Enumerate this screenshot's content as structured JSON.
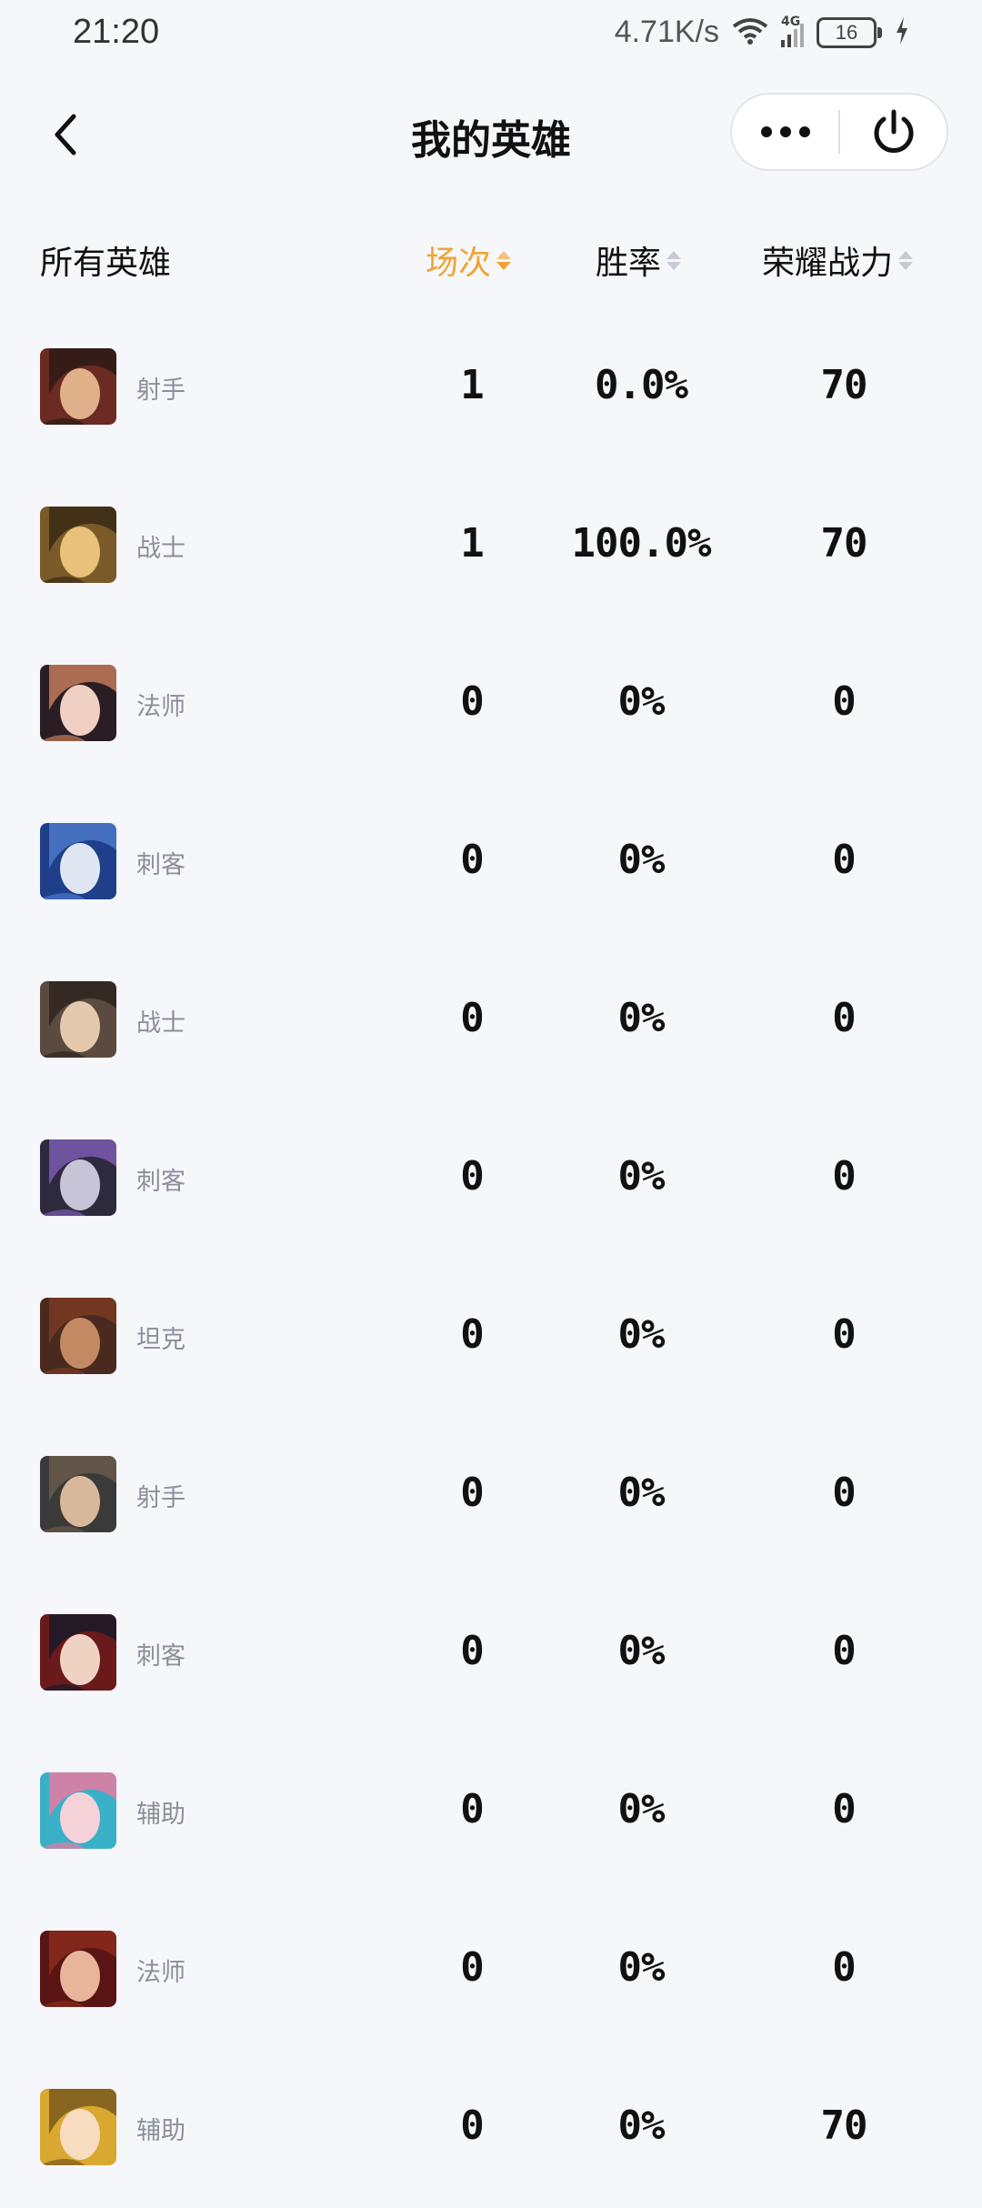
{
  "status_bar": {
    "time": "21:20",
    "net_speed": "4.71K/s",
    "network_type": "4G",
    "battery": "16"
  },
  "header": {
    "title": "我的英雄",
    "back_icon": "chevron-left-icon",
    "more_icon": "more-dots-icon",
    "close_icon": "power-icon"
  },
  "table": {
    "columns": {
      "all_heroes": "所有英雄",
      "games": "场次",
      "win_rate": "胜率",
      "power": "荣耀战力"
    },
    "active_sort_color": "#f0a432",
    "rows": [
      {
        "role": "射手",
        "games": "1",
        "win_rate": "0.0%",
        "power": "70",
        "avatar_colors": [
          "#6b2a22",
          "#e0b08a",
          "#2b1a15"
        ]
      },
      {
        "role": "战士",
        "games": "1",
        "win_rate": "100.0%",
        "power": "70",
        "avatar_colors": [
          "#7a5a28",
          "#e8c27a",
          "#3a2a14"
        ]
      },
      {
        "role": "法师",
        "games": "0",
        "win_rate": "0%",
        "power": "0",
        "avatar_colors": [
          "#2a1e24",
          "#f1d0c4",
          "#c27a5a"
        ]
      },
      {
        "role": "刺客",
        "games": "0",
        "win_rate": "0%",
        "power": "0",
        "avatar_colors": [
          "#1f3f8a",
          "#dfe6f2",
          "#4b79c8"
        ]
      },
      {
        "role": "战士",
        "games": "0",
        "win_rate": "0%",
        "power": "0",
        "avatar_colors": [
          "#5b4a40",
          "#e3c8ae",
          "#2e241e"
        ]
      },
      {
        "role": "刺客",
        "games": "0",
        "win_rate": "0%",
        "power": "0",
        "avatar_colors": [
          "#2e2a3e",
          "#c8c4d8",
          "#7a5ab0"
        ]
      },
      {
        "role": "坦克",
        "games": "0",
        "win_rate": "0%",
        "power": "0",
        "avatar_colors": [
          "#4a2a1e",
          "#c28a62",
          "#7a3a22"
        ]
      },
      {
        "role": "射手",
        "games": "0",
        "win_rate": "0%",
        "power": "0",
        "avatar_colors": [
          "#3a3a3a",
          "#d8b89a",
          "#6a5a4a"
        ]
      },
      {
        "role": "刺客",
        "games": "0",
        "win_rate": "0%",
        "power": "0",
        "avatar_colors": [
          "#6a1a1a",
          "#f0d2c2",
          "#1a1a2a"
        ]
      },
      {
        "role": "辅助",
        "games": "0",
        "win_rate": "0%",
        "power": "0",
        "avatar_colors": [
          "#3ab0c8",
          "#f4d2d8",
          "#e87aa0"
        ]
      },
      {
        "role": "法师",
        "games": "0",
        "win_rate": "0%",
        "power": "0",
        "avatar_colors": [
          "#5a1414",
          "#e8b49a",
          "#8a2a1a"
        ]
      },
      {
        "role": "辅助",
        "games": "0",
        "win_rate": "0%",
        "power": "70",
        "avatar_colors": [
          "#d8a830",
          "#f8dcc0",
          "#7a5a20"
        ]
      }
    ]
  }
}
